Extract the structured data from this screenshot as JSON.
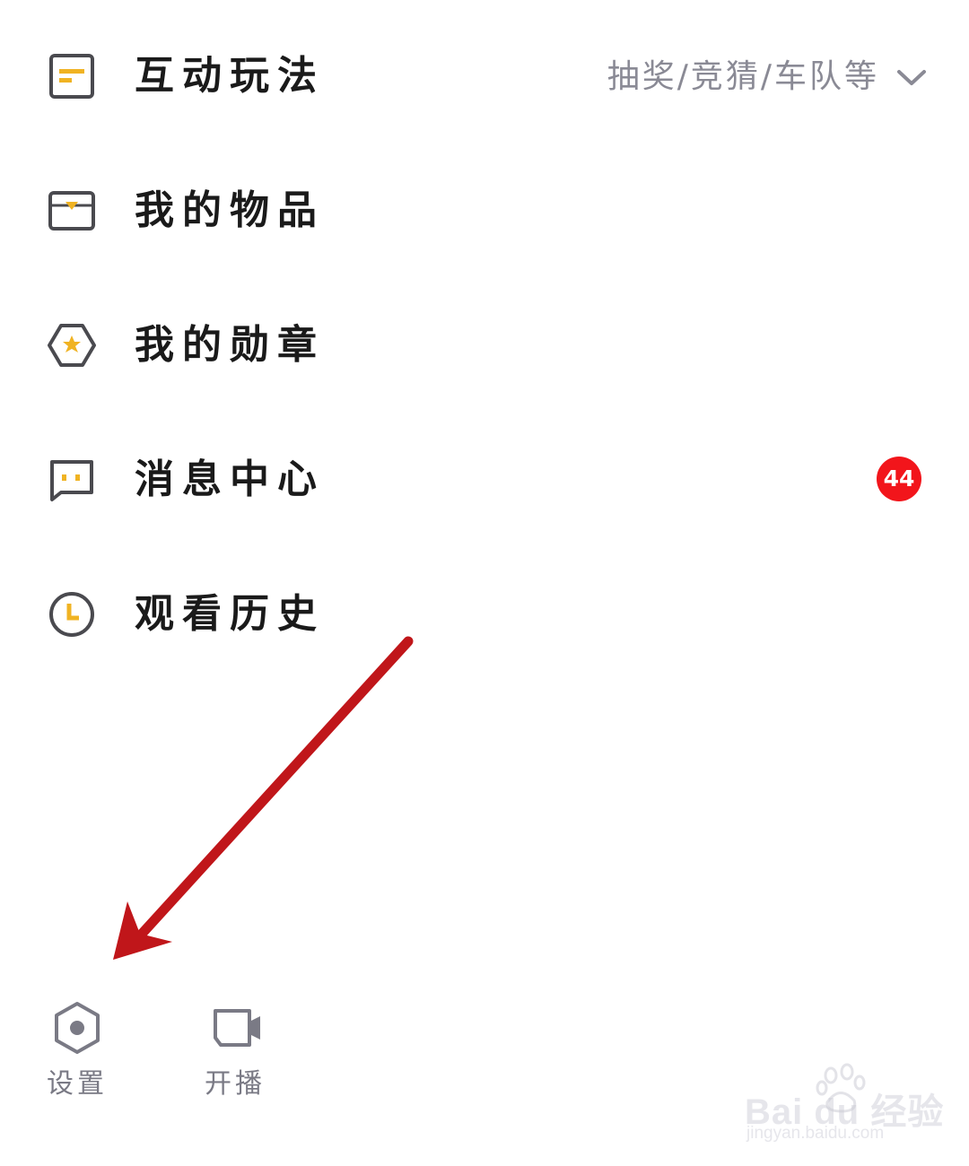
{
  "menu": {
    "items": [
      {
        "label": "互动玩法",
        "extra": "抽奖/竞猜/车队等"
      },
      {
        "label": "我的物品"
      },
      {
        "label": "我的勋章"
      },
      {
        "label": "消息中心",
        "badge": "44"
      },
      {
        "label": "观看历史"
      }
    ]
  },
  "bottom_bar": {
    "settings_label": "设置",
    "broadcast_label": "开播"
  },
  "watermark": {
    "logo": "Bai du 经验",
    "url": "jingyan.baidu.com"
  },
  "colors": {
    "accent_gold": "#f0b323",
    "icon_stroke": "#4a4a4f",
    "badge_red": "#f2151b",
    "annotation_arrow": "#c0161a"
  }
}
